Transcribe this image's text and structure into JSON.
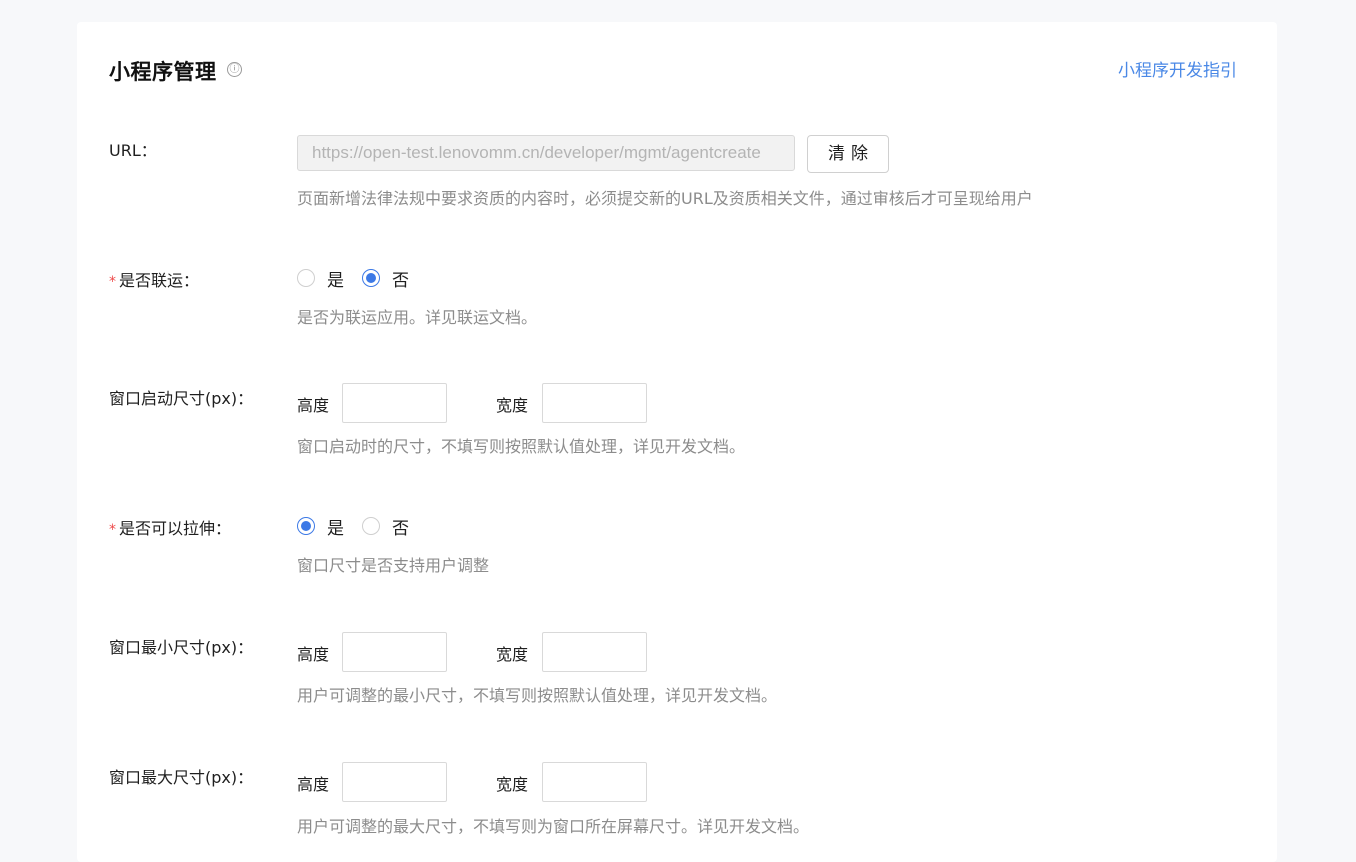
{
  "header": {
    "title": "小程序管理",
    "info_icon": "ⓘ",
    "guide_link": "小程序开发指引"
  },
  "url_field": {
    "label": "URL：",
    "value": "https://open-test.lenovomm.cn/developer/mgmt/agentcreate",
    "clear_button": "清除",
    "hint": "页面新增法律法规中要求资质的内容时，必须提交新的URL及资质相关文件，通过审核后才可呈现给用户"
  },
  "joint_operation": {
    "required_mark": "*",
    "label": "是否联运：",
    "options": [
      {
        "label": "是",
        "checked": false
      },
      {
        "label": "否",
        "checked": true
      }
    ],
    "hint": "是否为联运应用。详见联运文档。"
  },
  "launch_size": {
    "label": "窗口启动尺寸(px)：",
    "height_label": "高度",
    "width_label": "宽度",
    "height_value": "",
    "width_value": "",
    "hint": "窗口启动时的尺寸，不填写则按照默认值处理，详见开发文档。"
  },
  "resizable": {
    "required_mark": "*",
    "label": "是否可以拉伸：",
    "options": [
      {
        "label": "是",
        "checked": true
      },
      {
        "label": "否",
        "checked": false
      }
    ],
    "hint": "窗口尺寸是否支持用户调整"
  },
  "min_size": {
    "label": "窗口最小尺寸(px)：",
    "height_label": "高度",
    "width_label": "宽度",
    "height_value": "",
    "width_value": "",
    "hint": "用户可调整的最小尺寸，不填写则按照默认值处理，详见开发文档。"
  },
  "max_size": {
    "label": "窗口最大尺寸(px)：",
    "height_label": "高度",
    "width_label": "宽度",
    "height_value": "",
    "width_value": "",
    "hint": "用户可调整的最大尺寸，不填写则为窗口所在屏幕尺寸。详见开发文档。"
  },
  "colors": {
    "accent": "#3c79e6",
    "link": "#4a88e6",
    "required": "#ee4a4a",
    "hint_text": "#8c8c8c"
  }
}
